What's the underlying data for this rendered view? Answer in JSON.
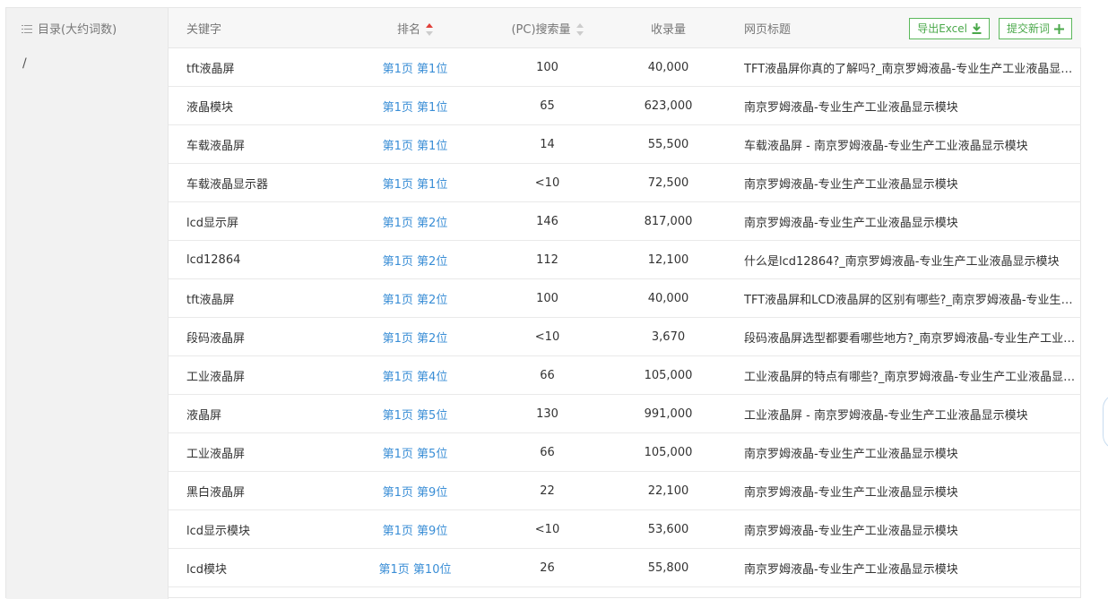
{
  "sidebar": {
    "toc_label": "目录(大约词数)",
    "slash": "/"
  },
  "table": {
    "headers": {
      "keyword": "关键字",
      "rank": "排名",
      "volume": "(PC)搜索量",
      "indexed": "收录量",
      "page_title": "网页标题"
    },
    "sort": {
      "rank": "ascending",
      "volume": "none"
    },
    "buttons": {
      "export": "导出Excel",
      "submit": "提交新词"
    },
    "accent_color": "#3a8ed6",
    "button_color": "#5cb85c",
    "rows": [
      {
        "keyword": "tft液晶屏",
        "rank": "第1页 第1位",
        "volume": "100",
        "indexed": "40,000",
        "title": "TFT液晶屏你真的了解吗?_南京罗姆液晶-专业生产工业液晶显示模块"
      },
      {
        "keyword": "液晶模块",
        "rank": "第1页 第1位",
        "volume": "65",
        "indexed": "623,000",
        "title": "南京罗姆液晶-专业生产工业液晶显示模块"
      },
      {
        "keyword": "车载液晶屏",
        "rank": "第1页 第1位",
        "volume": "14",
        "indexed": "55,500",
        "title": "车载液晶屏 - 南京罗姆液晶-专业生产工业液晶显示模块"
      },
      {
        "keyword": "车载液晶显示器",
        "rank": "第1页 第1位",
        "volume": "<10",
        "indexed": "72,500",
        "title": "南京罗姆液晶-专业生产工业液晶显示模块"
      },
      {
        "keyword": "lcd显示屏",
        "rank": "第1页 第2位",
        "volume": "146",
        "indexed": "817,000",
        "title": "南京罗姆液晶-专业生产工业液晶显示模块"
      },
      {
        "keyword": "lcd12864",
        "rank": "第1页 第2位",
        "volume": "112",
        "indexed": "12,100",
        "title": "什么是lcd12864?_南京罗姆液晶-专业生产工业液晶显示模块"
      },
      {
        "keyword": "tft液晶屏",
        "rank": "第1页 第2位",
        "volume": "100",
        "indexed": "40,000",
        "title": "TFT液晶屏和LCD液晶屏的区别有哪些?_南京罗姆液晶-专业生产工业液晶显示模块"
      },
      {
        "keyword": "段码液晶屏",
        "rank": "第1页 第2位",
        "volume": "<10",
        "indexed": "3,670",
        "title": "段码液晶屏选型都要看哪些地方?_南京罗姆液晶-专业生产工业液晶显示模块"
      },
      {
        "keyword": "工业液晶屏",
        "rank": "第1页 第4位",
        "volume": "66",
        "indexed": "105,000",
        "title": "工业液晶屏的特点有哪些?_南京罗姆液晶-专业生产工业液晶显示模块"
      },
      {
        "keyword": "液晶屏",
        "rank": "第1页 第5位",
        "volume": "130",
        "indexed": "991,000",
        "title": "工业液晶屏 - 南京罗姆液晶-专业生产工业液晶显示模块"
      },
      {
        "keyword": "工业液晶屏",
        "rank": "第1页 第5位",
        "volume": "66",
        "indexed": "105,000",
        "title": "南京罗姆液晶-专业生产工业液晶显示模块"
      },
      {
        "keyword": "黑白液晶屏",
        "rank": "第1页 第9位",
        "volume": "22",
        "indexed": "22,100",
        "title": "南京罗姆液晶-专业生产工业液晶显示模块"
      },
      {
        "keyword": "lcd显示模块",
        "rank": "第1页 第9位",
        "volume": "<10",
        "indexed": "53,600",
        "title": "南京罗姆液晶-专业生产工业液晶显示模块"
      },
      {
        "keyword": "lcd模块",
        "rank": "第1页 第10位",
        "volume": "26",
        "indexed": "55,800",
        "title": "南京罗姆液晶-专业生产工业液晶显示模块"
      }
    ]
  }
}
